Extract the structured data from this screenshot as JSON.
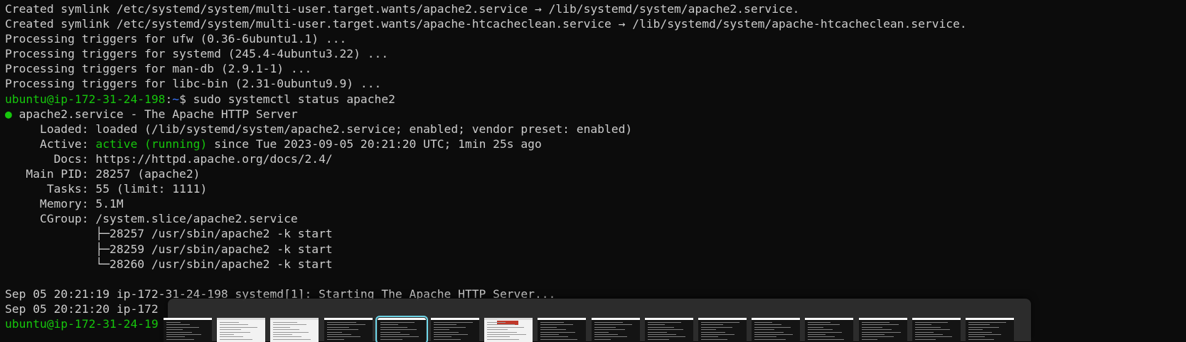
{
  "terminal": {
    "lines": [
      {
        "segments": [
          {
            "text": "Created symlink /etc/systemd/system/multi-user.target.wants/apache2.service → /lib/systemd/system/apache2.service.",
            "color": "default"
          }
        ]
      },
      {
        "segments": [
          {
            "text": "Created symlink /etc/systemd/system/multi-user.target.wants/apache-htcacheclean.service → /lib/systemd/system/apache-htcacheclean.service.",
            "color": "default"
          }
        ]
      },
      {
        "segments": [
          {
            "text": "Processing triggers for ufw (0.36-6ubuntu1.1) ...",
            "color": "default"
          }
        ]
      },
      {
        "segments": [
          {
            "text": "Processing triggers for systemd (245.4-4ubuntu3.22) ...",
            "color": "default"
          }
        ]
      },
      {
        "segments": [
          {
            "text": "Processing triggers for man-db (2.9.1-1) ...",
            "color": "default"
          }
        ]
      },
      {
        "segments": [
          {
            "text": "Processing triggers for libc-bin (2.31-0ubuntu9.9) ...",
            "color": "default"
          }
        ]
      },
      {
        "segments": [
          {
            "text": "ubuntu@ip-172-31-24-198",
            "color": "green"
          },
          {
            "text": ":",
            "color": "default"
          },
          {
            "text": "~",
            "color": "blue"
          },
          {
            "text": "$ sudo systemctl status apache2",
            "color": "default"
          }
        ]
      },
      {
        "segments": [
          {
            "text": "●",
            "color": "green"
          },
          {
            "text": " apache2.service - The Apache HTTP Server",
            "color": "default"
          }
        ]
      },
      {
        "segments": [
          {
            "text": "     Loaded: loaded (/lib/systemd/system/apache2.service; enabled; vendor preset: enabled)",
            "color": "default"
          }
        ]
      },
      {
        "segments": [
          {
            "text": "     Active: ",
            "color": "default"
          },
          {
            "text": "active (running)",
            "color": "green"
          },
          {
            "text": " since Tue 2023-09-05 20:21:20 UTC; 1min 25s ago",
            "color": "default"
          }
        ]
      },
      {
        "segments": [
          {
            "text": "       Docs: https://httpd.apache.org/docs/2.4/",
            "color": "default"
          }
        ]
      },
      {
        "segments": [
          {
            "text": "   Main PID: 28257 (apache2)",
            "color": "default"
          }
        ]
      },
      {
        "segments": [
          {
            "text": "      Tasks: 55 (limit: 1111)",
            "color": "default"
          }
        ]
      },
      {
        "segments": [
          {
            "text": "     Memory: 5.1M",
            "color": "default"
          }
        ]
      },
      {
        "segments": [
          {
            "text": "     CGroup: /system.slice/apache2.service",
            "color": "default"
          }
        ]
      },
      {
        "segments": [
          {
            "text": "             ├─28257 /usr/sbin/apache2 -k start",
            "color": "default"
          }
        ]
      },
      {
        "segments": [
          {
            "text": "             ├─28259 /usr/sbin/apache2 -k start",
            "color": "default"
          }
        ]
      },
      {
        "segments": [
          {
            "text": "             └─28260 /usr/sbin/apache2 -k start",
            "color": "default"
          }
        ]
      },
      {
        "segments": [
          {
            "text": "",
            "color": "default"
          }
        ]
      },
      {
        "segments": [
          {
            "text": "Sep 05 20:21:19 ip-172-31-24-198 systemd[1]: Starting The Apache HTTP Server...",
            "color": "default"
          }
        ]
      },
      {
        "segments": [
          {
            "text": "Sep 05 20:21:20 ip-172",
            "color": "default"
          }
        ]
      },
      {
        "segments": [
          {
            "text": "ubuntu@ip-172-31-24-19",
            "color": "green"
          }
        ]
      }
    ]
  },
  "colors": {
    "background": "#0c0c0c",
    "default": "#cccccc",
    "green": "#16c60c",
    "blue": "#3b78ff",
    "switcher_bg": "#2d2d2d",
    "selected_outline": "#6fd6e8"
  },
  "switcher": {
    "thumbnails": [
      {
        "kind": "dark"
      },
      {
        "kind": "light"
      },
      {
        "kind": "light"
      },
      {
        "kind": "dark"
      },
      {
        "kind": "dark",
        "selected": true
      },
      {
        "kind": "dark"
      },
      {
        "kind": "red"
      },
      {
        "kind": "dark"
      },
      {
        "kind": "dark"
      },
      {
        "kind": "dark"
      },
      {
        "kind": "dark"
      },
      {
        "kind": "dark"
      },
      {
        "kind": "dark"
      },
      {
        "kind": "dark"
      },
      {
        "kind": "dark"
      },
      {
        "kind": "dark"
      }
    ]
  }
}
